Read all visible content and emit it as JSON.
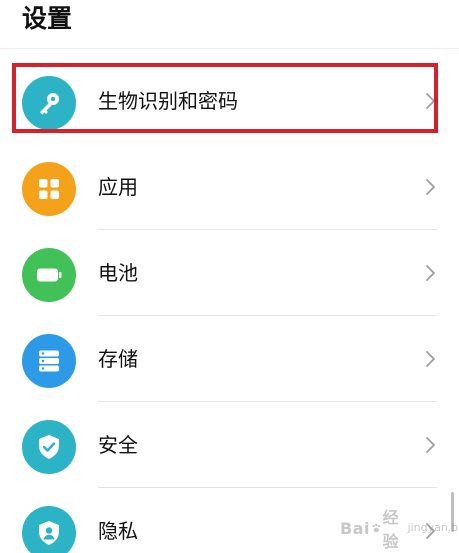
{
  "header": {
    "title": "设置"
  },
  "settings": {
    "items": [
      {
        "label": "生物识别和密码",
        "icon": "key-icon",
        "color": "#2cb3c6",
        "highlighted": true
      },
      {
        "label": "应用",
        "icon": "apps-grid-icon",
        "color": "#f5a21b",
        "highlighted": false
      },
      {
        "label": "电池",
        "icon": "battery-icon",
        "color": "#42c159",
        "highlighted": false
      },
      {
        "label": "存储",
        "icon": "storage-icon",
        "color": "#2d9ae8",
        "highlighted": false
      },
      {
        "label": "安全",
        "icon": "shield-check-icon",
        "color": "#2cb3c6",
        "highlighted": false
      },
      {
        "label": "隐私",
        "icon": "privacy-user-icon",
        "color": "#2cb3c6",
        "highlighted": false
      }
    ]
  },
  "annotation": {
    "highlight_color": "#d4212a"
  },
  "watermark": {
    "logo_left": "Bai",
    "logo_right": "经验",
    "caption": "jingyan.baidu.com"
  }
}
